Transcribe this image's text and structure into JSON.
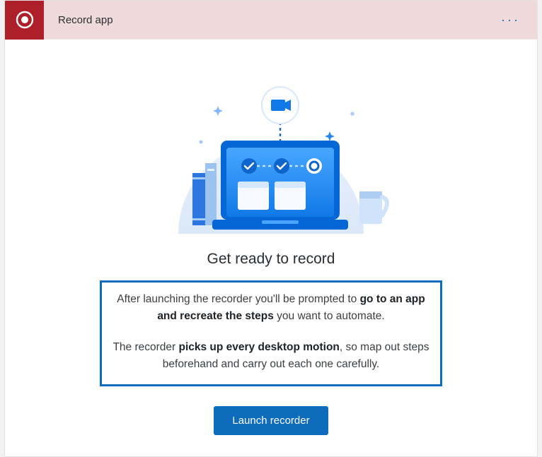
{
  "header": {
    "title": "Record app",
    "more_label": "···",
    "record_icon_name": "record-icon"
  },
  "heading": "Get ready to record",
  "info": {
    "p1_pre": "After launching the recorder you'll be prompted to ",
    "p1_bold": "go to an app and recreate the steps",
    "p1_post": " you want to automate.",
    "p2_pre": "The recorder ",
    "p2_bold": "picks up every desktop motion",
    "p2_post": ", so map out steps beforehand and carry out each one carefully."
  },
  "cta": {
    "launch_label": "Launch recorder"
  },
  "illustration": {
    "camera_icon_name": "camera-icon",
    "laptop_icon_name": "laptop-icon"
  },
  "colors": {
    "accent": "#0f6cbd",
    "header_bg": "#efd9da",
    "record_tile": "#ae2029"
  }
}
